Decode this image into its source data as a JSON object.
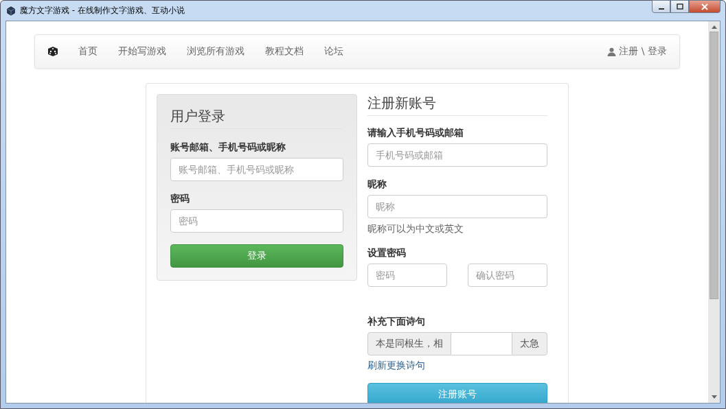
{
  "window": {
    "title": "魔方文字游戏 - 在线制作文字游戏、互动小说"
  },
  "navbar": {
    "items": [
      {
        "label": "首页"
      },
      {
        "label": "开始写游戏"
      },
      {
        "label": "浏览所有游戏"
      },
      {
        "label": "教程文档"
      },
      {
        "label": "论坛"
      }
    ],
    "user_link": "注册 \\ 登录"
  },
  "login": {
    "title": "用户登录",
    "fields": [
      {
        "label": "账号邮箱、手机号码或昵称",
        "placeholder": "账号邮箱、手机号码或昵称"
      },
      {
        "label": "密码",
        "placeholder": "密码"
      }
    ],
    "button": "登录"
  },
  "register": {
    "title": "注册新账号",
    "sections": [
      {
        "kind": "field",
        "label": "请输入手机号码或邮箱",
        "placeholder": "手机号码或邮箱"
      },
      {
        "kind": "field",
        "label": "昵称",
        "placeholder": "昵称",
        "help": "昵称可以为中文或英文"
      },
      {
        "kind": "pair",
        "label": "设置密码",
        "placeholders": [
          "密码",
          "确认密码"
        ]
      },
      {
        "kind": "poem",
        "label": "补充下面诗句",
        "prefix": "本是同根生，相",
        "suffix": "太急"
      }
    ],
    "refresh_link": "刷新更换诗句",
    "button": "注册账号"
  }
}
